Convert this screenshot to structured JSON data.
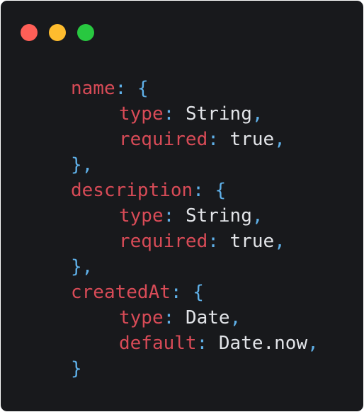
{
  "window": {
    "controls": [
      {
        "name": "close",
        "color": "#ff5f57"
      },
      {
        "name": "minimize",
        "color": "#febc2e"
      },
      {
        "name": "maximize",
        "color": "#28c840"
      }
    ]
  },
  "colors": {
    "background": "#18191c",
    "key": "#d84b57",
    "punctuation": "#5fb0e8",
    "value": "#e2e4e8"
  },
  "code": {
    "lines": [
      {
        "indent": 0,
        "key": "name",
        "colon": ":",
        "value": "",
        "open": "{",
        "close": "",
        "comma": ""
      },
      {
        "indent": 1,
        "key": "type",
        "colon": ":",
        "value": "String",
        "open": "",
        "close": "",
        "comma": ","
      },
      {
        "indent": 1,
        "key": "required",
        "colon": ":",
        "value": "true",
        "open": "",
        "close": "",
        "comma": ","
      },
      {
        "indent": 0,
        "key": "",
        "colon": "",
        "value": "",
        "open": "",
        "close": "}",
        "comma": ","
      },
      {
        "indent": 0,
        "key": "description",
        "colon": ":",
        "value": "",
        "open": "{",
        "close": "",
        "comma": ""
      },
      {
        "indent": 1,
        "key": "type",
        "colon": ":",
        "value": "String",
        "open": "",
        "close": "",
        "comma": ","
      },
      {
        "indent": 1,
        "key": "required",
        "colon": ":",
        "value": "true",
        "open": "",
        "close": "",
        "comma": ","
      },
      {
        "indent": 0,
        "key": "",
        "colon": "",
        "value": "",
        "open": "",
        "close": "}",
        "comma": ","
      },
      {
        "indent": 0,
        "key": "createdAt",
        "colon": ":",
        "value": "",
        "open": "{",
        "close": "",
        "comma": ""
      },
      {
        "indent": 1,
        "key": "type",
        "colon": ":",
        "value": "Date",
        "open": "",
        "close": "",
        "comma": ","
      },
      {
        "indent": 1,
        "key": "default",
        "colon": ":",
        "value": "Date.now",
        "open": "",
        "close": "",
        "comma": ","
      },
      {
        "indent": 0,
        "key": "",
        "colon": "",
        "value": "",
        "open": "",
        "close": "}",
        "comma": ""
      }
    ]
  }
}
